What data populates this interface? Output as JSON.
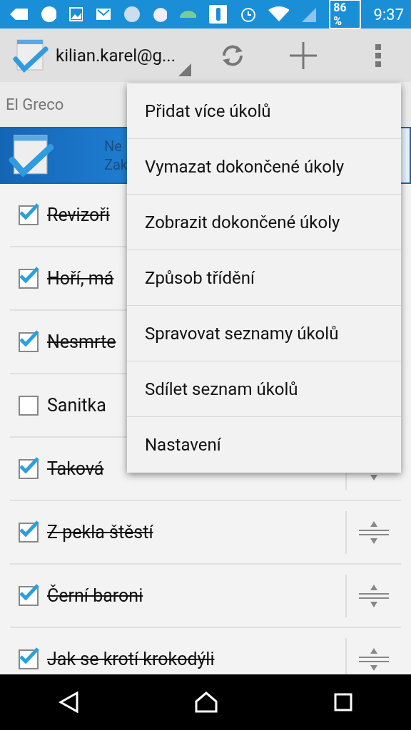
{
  "status_bar": {
    "battery": "86 %",
    "time": "9:37"
  },
  "action_bar": {
    "account": "kilian.karel@g..."
  },
  "list_header": {
    "title": "El Greco"
  },
  "banner": {
    "lines": [
      "Ne",
      "Zak"
    ]
  },
  "tasks": [
    {
      "title": "Revizoři",
      "checked": true
    },
    {
      "title": "Hoří, má",
      "checked": true
    },
    {
      "title": "Nesmrte",
      "checked": true
    },
    {
      "title": "Sanitka",
      "checked": false
    },
    {
      "title": "Taková",
      "checked": true
    },
    {
      "title": "Z pekla štěstí",
      "checked": true
    },
    {
      "title": "Černí baroni",
      "checked": true
    },
    {
      "title": "Jak se krotí krokodýli",
      "checked": true
    }
  ],
  "menu": [
    "Přidat více úkolů",
    "Vymazat dokončené úkoly",
    "Zobrazit dokončené úkoly",
    "Způsob třídění",
    "Spravovat seznamy úkolů",
    "Sdílet seznam úkolů",
    "Nastavení"
  ]
}
